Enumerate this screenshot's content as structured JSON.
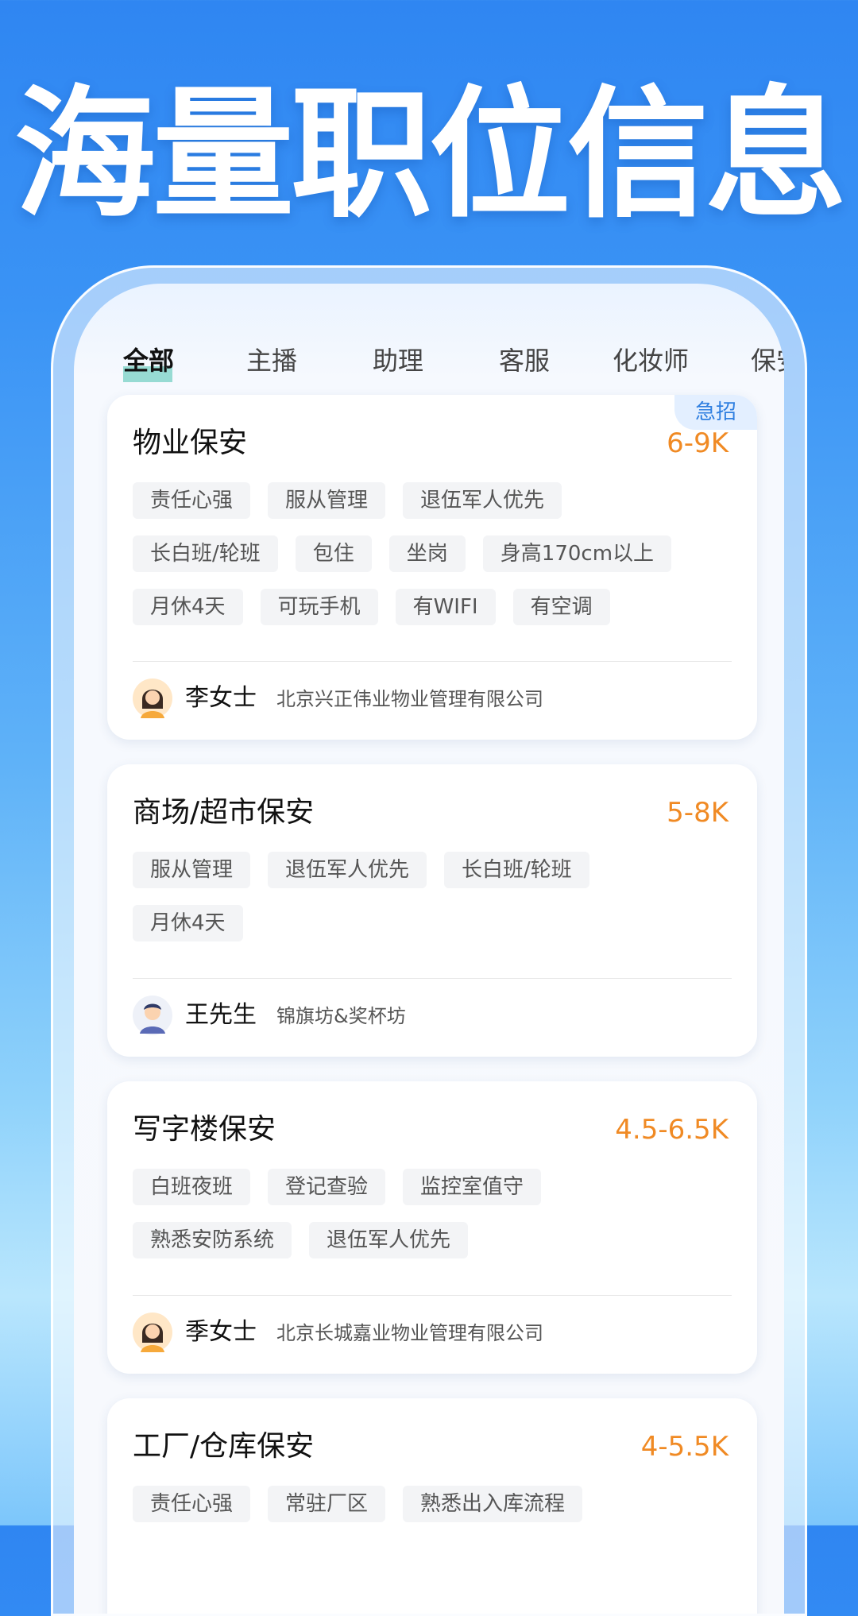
{
  "hero": {
    "title": "海量职位信息"
  },
  "tabs": [
    {
      "label": "全部",
      "active": true
    },
    {
      "label": "主播",
      "active": false
    },
    {
      "label": "助理",
      "active": false
    },
    {
      "label": "客服",
      "active": false
    },
    {
      "label": "化妆师",
      "active": false
    },
    {
      "label": "保安",
      "active": false
    }
  ],
  "jobs": [
    {
      "title": "物业保安",
      "salary": "6-9K",
      "badge": "急招",
      "tag_rows": [
        [
          "责任心强",
          "服从管理",
          "退伍军人优先"
        ],
        [
          "长白班/轮班",
          "包住",
          "坐岗",
          "身高170cm以上"
        ],
        [
          "月休4天",
          "可玩手机",
          "有WIFI",
          "有空调"
        ]
      ],
      "recruiter": {
        "name": "李女士",
        "avatar": "female-avatar-icon"
      },
      "company": "北京兴正伟业物业管理有限公司"
    },
    {
      "title": "商场/超市保安",
      "salary": "5-8K",
      "tag_rows": [
        [
          "服从管理",
          "退伍军人优先",
          "长白班/轮班"
        ],
        [
          "月休4天"
        ]
      ],
      "recruiter": {
        "name": "王先生",
        "avatar": "male-avatar-icon"
      },
      "company": "锦旗坊&奖杯坊"
    },
    {
      "title": "写字楼保安",
      "salary": "4.5-6.5K",
      "tag_rows": [
        [
          "白班夜班",
          "登记查验",
          "监控室值守"
        ],
        [
          "熟悉安防系统",
          "退伍军人优先"
        ]
      ],
      "recruiter": {
        "name": "季女士",
        "avatar": "female-avatar-icon"
      },
      "company": "北京长城嘉业物业管理有限公司"
    },
    {
      "title": "工厂/仓库保安",
      "salary": "4-5.5K",
      "tag_rows": [
        [
          "责任心强",
          "常驻厂区",
          "熟悉出入库流程"
        ]
      ]
    }
  ],
  "colors": {
    "brand_blue": "#3a93f5",
    "salary_orange": "#f08a24",
    "badge_blue": "#2f7fe0",
    "tab_underline": "#7fd3c8"
  }
}
